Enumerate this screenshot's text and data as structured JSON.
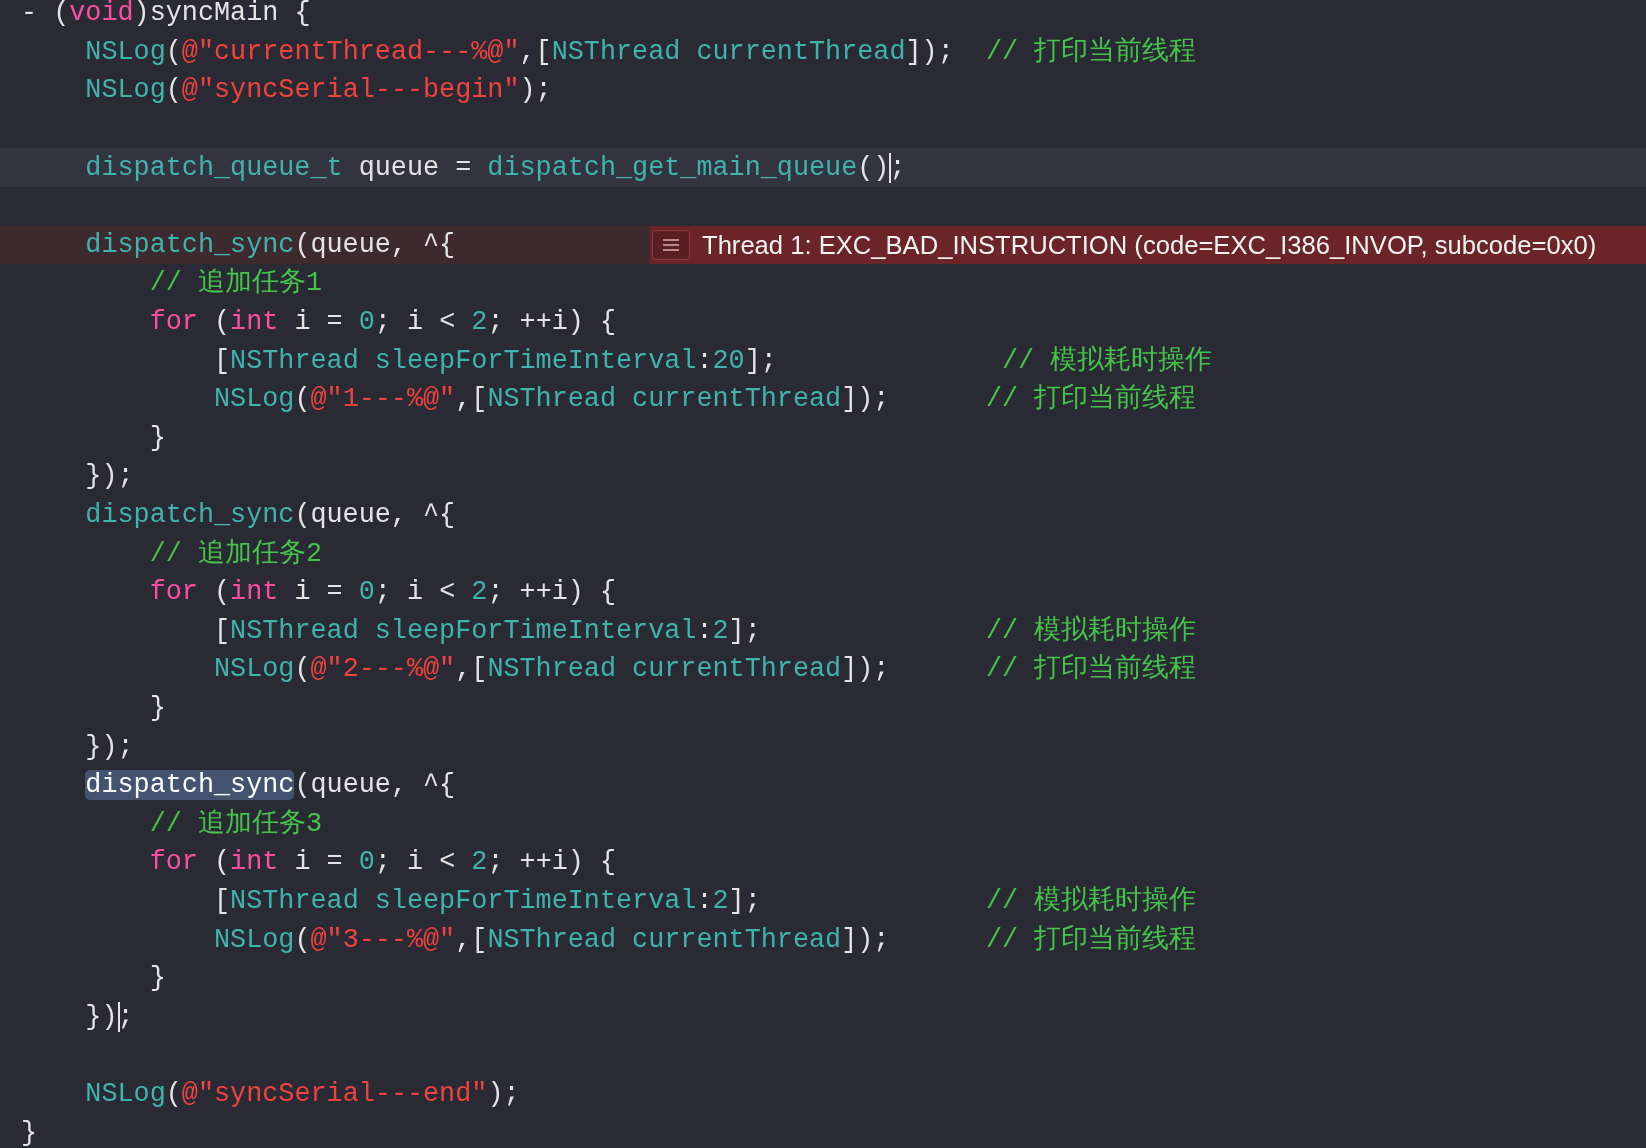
{
  "editor": {
    "lines": [
      {
        "kind": "normal",
        "tokens": [
          {
            "kind": "plain",
            "text": "- ("
          },
          {
            "kind": "keyword",
            "text": "void"
          },
          {
            "kind": "plain",
            "text": ")syncMain {"
          }
        ]
      },
      {
        "kind": "normal",
        "tokens": [
          {
            "kind": "func",
            "text": "    NSLog"
          },
          {
            "kind": "plain",
            "text": "("
          },
          {
            "kind": "string",
            "text": "@\"currentThread---%@\""
          },
          {
            "kind": "plain",
            "text": ",["
          },
          {
            "kind": "func",
            "text": "NSThread currentThread"
          },
          {
            "kind": "plain",
            "text": "]);  "
          },
          {
            "kind": "comment",
            "text": "// 打印当前线程"
          }
        ]
      },
      {
        "kind": "normal",
        "tokens": [
          {
            "kind": "func",
            "text": "    NSLog"
          },
          {
            "kind": "plain",
            "text": "("
          },
          {
            "kind": "string",
            "text": "@\"syncSerial---begin\""
          },
          {
            "kind": "plain",
            "text": ");"
          }
        ]
      },
      {
        "kind": "normal"
      },
      {
        "kind": "current",
        "tokens": [
          {
            "kind": "func",
            "text": "    dispatch_queue_t"
          },
          {
            "kind": "plain",
            "text": " queue = "
          },
          {
            "kind": "func",
            "text": "dispatch_get_main_queue"
          },
          {
            "kind": "plain",
            "text": "()"
          },
          {
            "kind": "caret"
          },
          {
            "kind": "plain",
            "text": ";"
          }
        ]
      },
      {
        "kind": "normal"
      },
      {
        "kind": "error",
        "tokens": [
          {
            "kind": "func",
            "text": "    dispatch_sync"
          },
          {
            "kind": "plain",
            "text": "(queue, ^{"
          }
        ],
        "annotation": {
          "kind": "error",
          "text": "Thread 1: EXC_BAD_INSTRUCTION (code=EXC_I386_INVOP, subcode=0x0)"
        }
      },
      {
        "kind": "normal",
        "tokens": [
          {
            "kind": "comment",
            "text": "        // 追加任务1"
          }
        ]
      },
      {
        "kind": "normal",
        "tokens": [
          {
            "kind": "keyword",
            "text": "        for"
          },
          {
            "kind": "plain",
            "text": " ("
          },
          {
            "kind": "keyword",
            "text": "int"
          },
          {
            "kind": "plain",
            "text": " i = "
          },
          {
            "kind": "number",
            "text": "0"
          },
          {
            "kind": "plain",
            "text": "; i < "
          },
          {
            "kind": "number",
            "text": "2"
          },
          {
            "kind": "plain",
            "text": "; ++i) {"
          }
        ]
      },
      {
        "kind": "normal",
        "tokens": [
          {
            "kind": "plain",
            "text": "            ["
          },
          {
            "kind": "func",
            "text": "NSThread sleepForTimeInterval"
          },
          {
            "kind": "plain",
            "text": ":"
          },
          {
            "kind": "number",
            "text": "20"
          },
          {
            "kind": "plain",
            "text": "];              "
          },
          {
            "kind": "comment",
            "text": "// 模拟耗时操作"
          }
        ]
      },
      {
        "kind": "normal",
        "tokens": [
          {
            "kind": "func",
            "text": "            NSLog"
          },
          {
            "kind": "plain",
            "text": "("
          },
          {
            "kind": "string",
            "text": "@\"1---%@\""
          },
          {
            "kind": "plain",
            "text": ",["
          },
          {
            "kind": "func",
            "text": "NSThread currentThread"
          },
          {
            "kind": "plain",
            "text": "]);      "
          },
          {
            "kind": "comment",
            "text": "// 打印当前线程"
          }
        ]
      },
      {
        "kind": "normal",
        "tokens": [
          {
            "kind": "plain",
            "text": "        }"
          }
        ]
      },
      {
        "kind": "normal",
        "tokens": [
          {
            "kind": "plain",
            "text": "    });"
          }
        ]
      },
      {
        "kind": "normal",
        "tokens": [
          {
            "kind": "func",
            "text": "    dispatch_sync"
          },
          {
            "kind": "plain",
            "text": "(queue, ^{"
          }
        ]
      },
      {
        "kind": "normal",
        "tokens": [
          {
            "kind": "comment",
            "text": "        // 追加任务2"
          }
        ]
      },
      {
        "kind": "normal",
        "tokens": [
          {
            "kind": "keyword",
            "text": "        for"
          },
          {
            "kind": "plain",
            "text": " ("
          },
          {
            "kind": "keyword",
            "text": "int"
          },
          {
            "kind": "plain",
            "text": " i = "
          },
          {
            "kind": "number",
            "text": "0"
          },
          {
            "kind": "plain",
            "text": "; i < "
          },
          {
            "kind": "number",
            "text": "2"
          },
          {
            "kind": "plain",
            "text": "; ++i) {"
          }
        ]
      },
      {
        "kind": "normal",
        "tokens": [
          {
            "kind": "plain",
            "text": "            ["
          },
          {
            "kind": "func",
            "text": "NSThread sleepForTimeInterval"
          },
          {
            "kind": "plain",
            "text": ":"
          },
          {
            "kind": "number",
            "text": "2"
          },
          {
            "kind": "plain",
            "text": "];              "
          },
          {
            "kind": "comment",
            "text": "// 模拟耗时操作"
          }
        ]
      },
      {
        "kind": "normal",
        "tokens": [
          {
            "kind": "func",
            "text": "            NSLog"
          },
          {
            "kind": "plain",
            "text": "("
          },
          {
            "kind": "string",
            "text": "@\"2---%@\""
          },
          {
            "kind": "plain",
            "text": ",["
          },
          {
            "kind": "func",
            "text": "NSThread currentThread"
          },
          {
            "kind": "plain",
            "text": "]);      "
          },
          {
            "kind": "comment",
            "text": "// 打印当前线程"
          }
        ]
      },
      {
        "kind": "normal",
        "tokens": [
          {
            "kind": "plain",
            "text": "        }"
          }
        ]
      },
      {
        "kind": "normal",
        "tokens": [
          {
            "kind": "plain",
            "text": "    });"
          }
        ]
      },
      {
        "kind": "normal",
        "tokens": [
          {
            "kind": "func",
            "text": "    dispatch_sync",
            "selected": true
          },
          {
            "kind": "plain",
            "text": "(queue, ^{"
          }
        ]
      },
      {
        "kind": "normal",
        "tokens": [
          {
            "kind": "comment",
            "text": "        // 追加任务3"
          }
        ]
      },
      {
        "kind": "normal",
        "tokens": [
          {
            "kind": "keyword",
            "text": "        for"
          },
          {
            "kind": "plain",
            "text": " ("
          },
          {
            "kind": "keyword",
            "text": "int"
          },
          {
            "kind": "plain",
            "text": " i = "
          },
          {
            "kind": "number",
            "text": "0"
          },
          {
            "kind": "plain",
            "text": "; i < "
          },
          {
            "kind": "number",
            "text": "2"
          },
          {
            "kind": "plain",
            "text": "; ++i) {"
          }
        ]
      },
      {
        "kind": "normal",
        "tokens": [
          {
            "kind": "plain",
            "text": "            ["
          },
          {
            "kind": "func",
            "text": "NSThread sleepForTimeInterval"
          },
          {
            "kind": "plain",
            "text": ":"
          },
          {
            "kind": "number",
            "text": "2"
          },
          {
            "kind": "plain",
            "text": "];              "
          },
          {
            "kind": "comment",
            "text": "// 模拟耗时操作"
          }
        ]
      },
      {
        "kind": "normal",
        "tokens": [
          {
            "kind": "func",
            "text": "            NSLog"
          },
          {
            "kind": "plain",
            "text": "("
          },
          {
            "kind": "string",
            "text": "@\"3---%@\""
          },
          {
            "kind": "plain",
            "text": ",["
          },
          {
            "kind": "func",
            "text": "NSThread currentThread"
          },
          {
            "kind": "plain",
            "text": "]);      "
          },
          {
            "kind": "comment",
            "text": "// 打印当前线程"
          }
        ]
      },
      {
        "kind": "normal",
        "tokens": [
          {
            "kind": "plain",
            "text": "        }"
          }
        ]
      },
      {
        "kind": "normal",
        "tokens": [
          {
            "kind": "plain",
            "text": "    })"
          },
          {
            "kind": "caret"
          },
          {
            "kind": "plain",
            "text": ";"
          }
        ]
      },
      {
        "kind": "normal"
      },
      {
        "kind": "normal",
        "tokens": [
          {
            "kind": "func",
            "text": "    NSLog"
          },
          {
            "kind": "plain",
            "text": "("
          },
          {
            "kind": "string",
            "text": "@\"syncSerial---end\""
          },
          {
            "kind": "plain",
            "text": ");"
          }
        ]
      },
      {
        "kind": "normal",
        "tokens": [
          {
            "kind": "plain",
            "text": "}"
          }
        ]
      }
    ]
  }
}
